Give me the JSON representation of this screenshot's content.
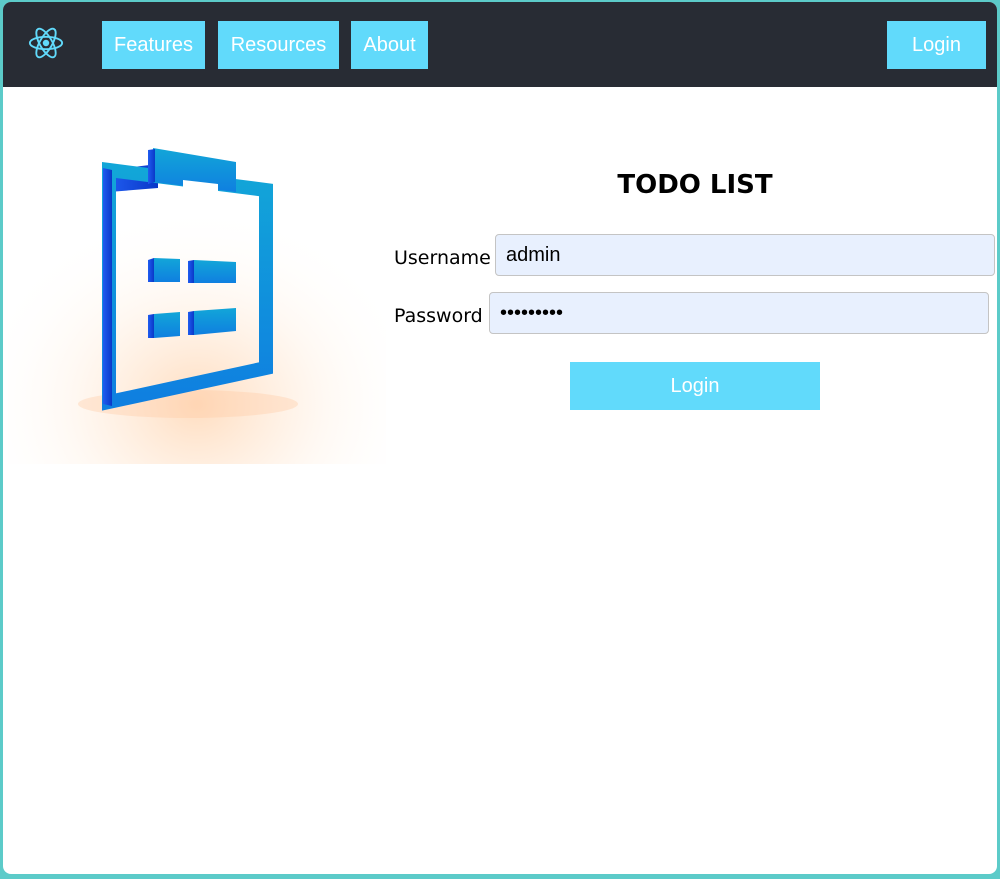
{
  "navbar": {
    "logo_icon": "react-atom-icon",
    "accent_color": "#61dafb",
    "background_color": "#282c34",
    "links": [
      {
        "label": "Features"
      },
      {
        "label": "Resources"
      },
      {
        "label": "About"
      }
    ],
    "login_label": "Login"
  },
  "hero": {
    "image": "clipboard-checklist-icon"
  },
  "login_form": {
    "title": "TODO LIST",
    "username_label": "Username",
    "username_value": "admin",
    "password_label": "Password",
    "password_value": "•••••••••",
    "submit_label": "Login"
  }
}
